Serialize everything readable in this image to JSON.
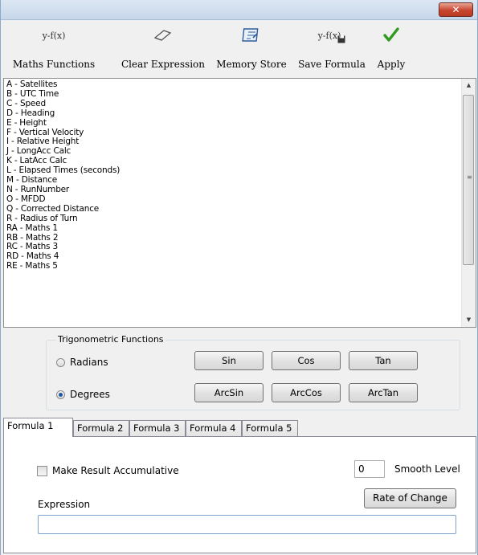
{
  "toolbar": {
    "items": [
      {
        "label": "Maths Functions",
        "icon": "fx-icon"
      },
      {
        "label": "Clear Expression",
        "icon": "eraser-icon"
      },
      {
        "label": "Memory Store",
        "icon": "memory-icon"
      },
      {
        "label": "Save Formula",
        "icon": "save-fx-icon"
      },
      {
        "label": "Apply",
        "icon": "checkmark-icon"
      }
    ],
    "fx_glyph": "y-f(x)"
  },
  "channels": [
    "A - Satellites",
    "B - UTC Time",
    "C - Speed",
    "D - Heading",
    "E - Height",
    "F - Vertical Velocity",
    "I - Relative Height",
    "J - LongAcc Calc",
    "K - LatAcc Calc",
    "L - Elapsed Times (seconds)",
    "M - Distance",
    "N - RunNumber",
    "O - MFDD",
    "Q - Corrected Distance",
    "R - Radius of Turn",
    "RA - Maths 1",
    "RB - Maths 2",
    "RC - Maths 3",
    "RD - Maths 4",
    "RE - Maths 5"
  ],
  "trig": {
    "title": "Trigonometric Functions",
    "radians_label": "Radians",
    "degrees_label": "Degrees",
    "selected": "Degrees",
    "buttons": [
      "Sin",
      "Cos",
      "Tan",
      "ArcSin",
      "ArcCos",
      "ArcTan"
    ]
  },
  "tabs": [
    "Formula 1",
    "Formula 2",
    "Formula 3",
    "Formula 4",
    "Formula 5"
  ],
  "active_tab": "Formula 1",
  "formula": {
    "accumulative_label": "Make Result Accumulative",
    "accumulative_checked": false,
    "smooth_value": "0",
    "smooth_label": "Smooth Level",
    "rate_button": "Rate of Change",
    "expression_label": "Expression",
    "expression_value": ""
  },
  "colors": {
    "close_button": "#c8462f",
    "apply_check": "#2f9a1f",
    "accent_border": "#7da2ce"
  }
}
